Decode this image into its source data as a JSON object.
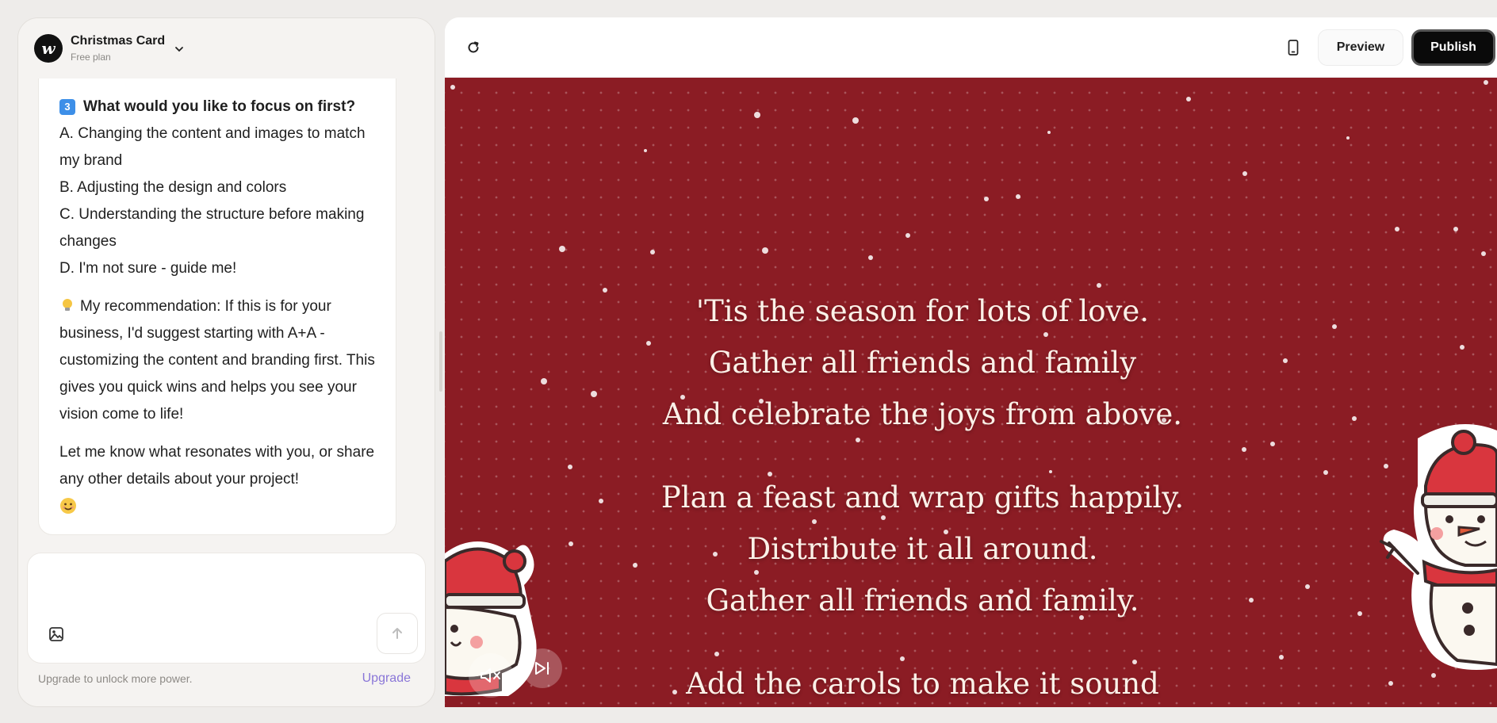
{
  "project": {
    "title": "Christmas Card",
    "plan": "Free plan",
    "logo_letter": "w"
  },
  "chat": {
    "question": "What would you like to focus on first?",
    "question_key": "3",
    "options": [
      "A. Changing the content and images to match my brand",
      "B. Adjusting the design and colors",
      "C. Understanding the structure before making changes",
      "D. I'm not sure - guide me!"
    ],
    "recommendation": "My recommendation: If this is for your business, I'd suggest starting with A+A - customizing the content and branding first. This gives you quick wins and helps you see your vision come to life!",
    "closing": "Let me know what resonates with you, or share any other details about your project!"
  },
  "composer": {
    "placeholder": ""
  },
  "footer": {
    "note": "Upgrade to unlock more power.",
    "upgrade_label": "Upgrade"
  },
  "toolbar": {
    "preview_label": "Preview",
    "publish_label": "Publish"
  },
  "card": {
    "stanzas": [
      [
        "'Tis the season for lots of love.",
        "Gather all friends and family",
        "And celebrate the joys from above."
      ],
      [
        "Plan a feast and wrap gifts happily.",
        "Distribute it all around.",
        "Gather all friends and family."
      ],
      [
        "Add the carols to make it sound"
      ]
    ],
    "colors": {
      "background": "#8b1c24",
      "text": "#fbf1e8",
      "hat": "#d9363e"
    }
  },
  "icons": [
    "refresh-icon",
    "phone-icon",
    "chevron-down-icon",
    "image-attach-icon",
    "arrow-up-icon",
    "mute-icon",
    "skip-next-icon",
    "lightbulb-icon",
    "smile-emoji-icon"
  ]
}
